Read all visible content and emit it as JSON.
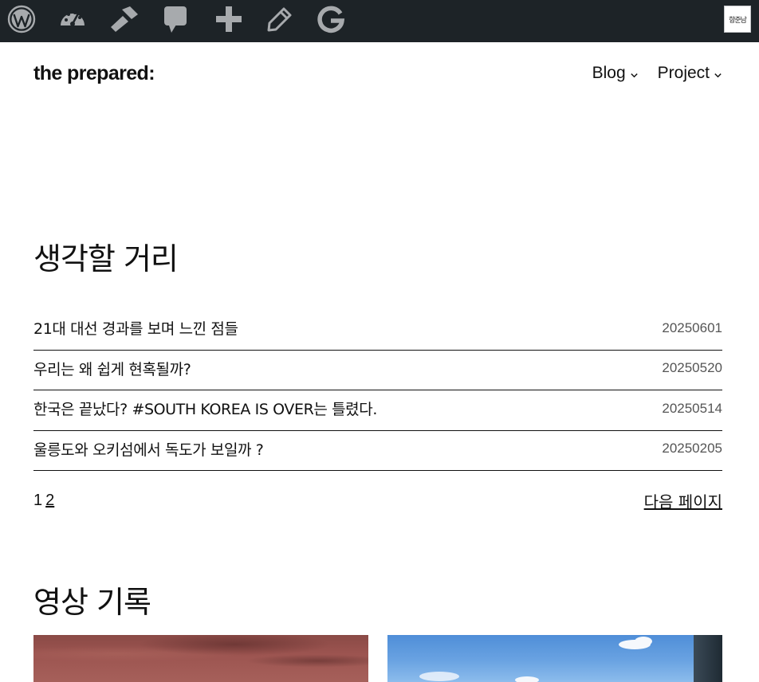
{
  "admin_bar": {
    "icons": [
      "wordpress-icon",
      "dashboard-icon",
      "customize-icon",
      "comments-icon",
      "new-content-icon",
      "edit-icon",
      "site-kit-icon"
    ],
    "avatar_text": "항준남",
    "bg_color": "#1d2327",
    "icon_color": "#a7aaad"
  },
  "header": {
    "site_title": "the prepared:",
    "nav": [
      {
        "label": "Blog"
      },
      {
        "label": "Project"
      }
    ]
  },
  "posts_section": {
    "heading": "생각할 거리",
    "posts": [
      {
        "title": "21대 대선 경과를 보며 느낀 점들",
        "date": "20250601"
      },
      {
        "title": "우리는 왜 쉽게 현혹될까?",
        "date": "20250520"
      },
      {
        "title": "한국은 끝났다? #SOUTH KOREA IS OVER는 틀렸다.",
        "date": "20250514"
      },
      {
        "title": "울릉도와 오키섬에서 독도가 보일까 ?",
        "date": "20250205"
      }
    ],
    "pagination": {
      "current": "1",
      "pages": [
        "2"
      ],
      "next_label": "다음 페이지"
    }
  },
  "video_section": {
    "heading": "영상 기록"
  }
}
